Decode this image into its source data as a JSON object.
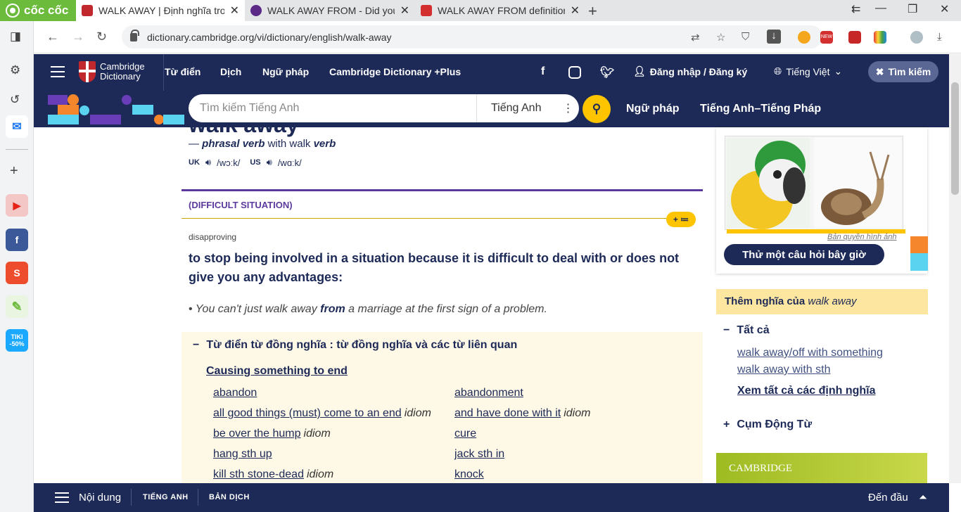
{
  "browser": {
    "brand": "cốc cốc",
    "tabs": [
      {
        "title": "WALK AWAY | Định nghĩa tron",
        "fav_color": "#c0282d"
      },
      {
        "title": "WALK AWAY FROM - Did you",
        "fav_color": "#5b2a86"
      },
      {
        "title": "WALK AWAY FROM definition",
        "fav_color": "#d32f2f"
      }
    ],
    "url": "dictionary.cambridge.org/vi/dictionary/english/walk-away"
  },
  "site": {
    "logo_line1": "Cambridge",
    "logo_line2": "Dictionary",
    "nav": [
      "Từ điển",
      "Dịch",
      "Ngữ pháp",
      "Cambridge Dictionary +Plus"
    ],
    "login": "Đăng nhập / Đăng ký",
    "language": "Tiếng Việt",
    "search_button": "Tìm kiếm",
    "search_placeholder": "Tìm kiếm Tiếng Anh",
    "search_dict": "Tiếng Anh",
    "second_links": [
      "Ngữ pháp",
      "Tiếng Anh–Tiếng Pháp"
    ]
  },
  "entry": {
    "headword": "walk away",
    "pos_dash": "—",
    "pos": "phrasal verb",
    "pos_with": "with walk",
    "pos_verb": "verb",
    "uk_label": "UK",
    "uk_ipa": "/wɔːk/",
    "us_label": "US",
    "us_ipa": "/wɑːk/",
    "sense": "(DIFFICULT SITUATION)",
    "pill": "+ ≔",
    "grammar": "disapproving",
    "definition": "to stop being involved in a situation because it is difficult to deal with or does not give you any advantages:",
    "example_pre": "You can't just walk away",
    "example_bold": "from",
    "example_post": "a marriage at the first sign of a problem.",
    "thesaurus_title": "Từ điển từ đồng nghĩa : từ đồng nghĩa và các từ liên quan",
    "thesaurus_sub": "Causing something to end",
    "thesaurus_left": [
      {
        "word": "abandon",
        "tag": ""
      },
      {
        "word": "all good things (must) come to an end",
        "tag": "idiom"
      },
      {
        "word": "be over the hump",
        "tag": "idiom"
      },
      {
        "word": "hang sth up",
        "tag": ""
      },
      {
        "word": "kill sth stone-dead",
        "tag": "idiom"
      }
    ],
    "thesaurus_right": [
      {
        "word": "abandonment",
        "tag": ""
      },
      {
        "word": "and have done with it",
        "tag": "idiom"
      },
      {
        "word": "cure",
        "tag": ""
      },
      {
        "word": "jack sth in",
        "tag": ""
      },
      {
        "word": "knock",
        "tag": ""
      }
    ]
  },
  "right": {
    "copyright": "Bản quyền hình ảnh",
    "quiz_button": "Thử một câu hỏi bây giờ",
    "more_prefix": "Thêm nghĩa của",
    "more_word": "walk away",
    "all_label": "Tất cả",
    "links": [
      "walk away/off with something",
      "walk away with sth"
    ],
    "see_all": "Xem tất cả các định nghĩa",
    "phrasal": "Cụm Động Từ",
    "ad_text": "CAMBRIDGE"
  },
  "bottom": {
    "contents": "Nội dung",
    "english": "TIẾNG ANH",
    "translation": "BẢN DỊCH",
    "top": "Đến đầu"
  },
  "sidebar_tiki": "TIKI -50%",
  "accent_colors": {
    "navy": "#1d2a57",
    "yellow": "#fec400",
    "purple": "#5c3a9d"
  }
}
